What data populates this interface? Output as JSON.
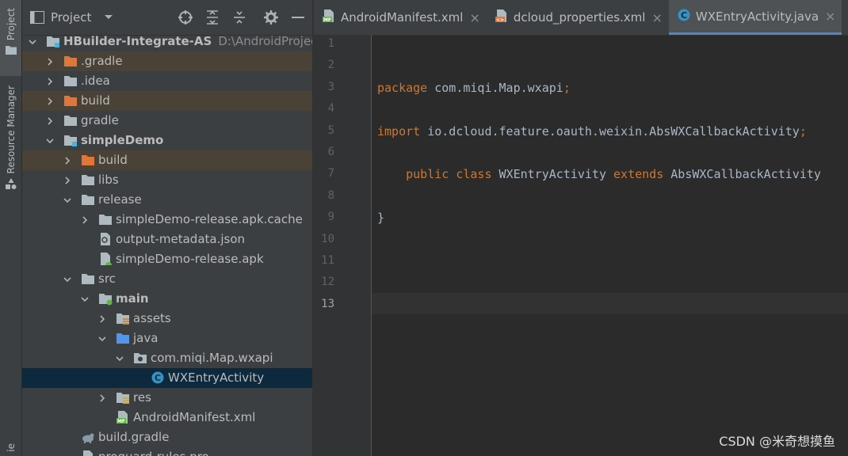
{
  "left_stripe": {
    "tabs": [
      {
        "label": "Project",
        "icon": "folder-icon",
        "active": true
      },
      {
        "label": "Resource Manager",
        "icon": "resource-manager-icon",
        "active": false
      },
      {
        "label": "ie",
        "icon": "",
        "active": false
      }
    ]
  },
  "project_panel": {
    "title": "Project",
    "view_dropdown": "chevron-down-icon",
    "actions": [
      "locate-icon",
      "expand-all-icon",
      "collapse-all-icon",
      "gear-icon",
      "hide-icon"
    ],
    "tree": [
      {
        "label": "HBuilder-Integrate-AS",
        "path": "D:\\AndroidProject\\",
        "depth": 0,
        "icon": "module-folder-icon",
        "expanded": true,
        "bold": true,
        "style": "normal"
      },
      {
        "label": ".gradle",
        "depth": 1,
        "icon": "folder-excluded-icon",
        "expanded": false,
        "style": "excluded"
      },
      {
        "label": ".idea",
        "depth": 1,
        "icon": "folder-icon",
        "expanded": false,
        "style": "normal"
      },
      {
        "label": "build",
        "depth": 1,
        "icon": "folder-excluded-icon",
        "expanded": false,
        "style": "excluded"
      },
      {
        "label": "gradle",
        "depth": 1,
        "icon": "folder-icon",
        "expanded": false,
        "style": "normal"
      },
      {
        "label": "simpleDemo",
        "depth": 1,
        "icon": "module-folder-icon",
        "expanded": true,
        "bold": true,
        "style": "normal"
      },
      {
        "label": "build",
        "depth": 2,
        "icon": "folder-excluded-icon",
        "expanded": false,
        "style": "excluded"
      },
      {
        "label": "libs",
        "depth": 2,
        "icon": "folder-icon",
        "expanded": false,
        "style": "normal"
      },
      {
        "label": "release",
        "depth": 2,
        "icon": "folder-icon",
        "expanded": true,
        "style": "normal"
      },
      {
        "label": "simpleDemo-release.apk.cache",
        "depth": 3,
        "icon": "folder-icon",
        "expanded": false,
        "style": "normal"
      },
      {
        "label": "output-metadata.json",
        "depth": 3,
        "icon": "json-file-icon",
        "leaf": true,
        "style": "normal"
      },
      {
        "label": "simpleDemo-release.apk",
        "depth": 3,
        "icon": "apk-file-icon",
        "leaf": true,
        "style": "normal"
      },
      {
        "label": "src",
        "depth": 2,
        "icon": "folder-icon",
        "expanded": true,
        "style": "normal"
      },
      {
        "label": "main",
        "depth": 3,
        "icon": "source-set-folder-icon",
        "expanded": true,
        "bold": true,
        "style": "normal"
      },
      {
        "label": "assets",
        "depth": 4,
        "icon": "assets-folder-icon",
        "expanded": false,
        "style": "normal"
      },
      {
        "label": "java",
        "depth": 4,
        "icon": "source-root-folder-icon",
        "expanded": true,
        "style": "normal"
      },
      {
        "label": "com.miqi.Map.wxapi",
        "depth": 5,
        "icon": "package-icon",
        "expanded": true,
        "style": "normal"
      },
      {
        "label": "WXEntryActivity",
        "depth": 6,
        "icon": "java-class-icon",
        "leaf": true,
        "style": "selected"
      },
      {
        "label": "res",
        "depth": 4,
        "icon": "resources-folder-icon",
        "expanded": false,
        "style": "normal"
      },
      {
        "label": "AndroidManifest.xml",
        "depth": 4,
        "icon": "manifest-file-icon",
        "leaf": true,
        "style": "normal"
      },
      {
        "label": "build.gradle",
        "depth": 2,
        "icon": "gradle-file-icon",
        "leaf": true,
        "style": "normal"
      },
      {
        "label": "proguard-rules.pro",
        "depth": 2,
        "icon": "file-icon",
        "leaf": true,
        "style": "normal"
      }
    ]
  },
  "editor": {
    "tabs": [
      {
        "label": "AndroidManifest.xml",
        "icon": "manifest-file-icon",
        "active": false
      },
      {
        "label": "dcloud_properties.xml",
        "icon": "xml-file-icon",
        "active": false
      },
      {
        "label": "WXEntryActivity.java",
        "icon": "java-class-icon",
        "active": true
      }
    ],
    "close_glyph": "×",
    "current_line": 13,
    "lines": [
      {
        "n": "1",
        "segments": []
      },
      {
        "n": "2",
        "segments": []
      },
      {
        "n": "3",
        "segments": [
          {
            "t": "package",
            "c": "kw"
          },
          {
            "t": " com.miqi.Map.wxapi",
            "c": "id"
          },
          {
            "t": ";",
            "c": "kw"
          }
        ]
      },
      {
        "n": "4",
        "segments": []
      },
      {
        "n": "5",
        "segments": [
          {
            "t": "import",
            "c": "kw"
          },
          {
            "t": " io.dcloud.feature.oauth.weixin.AbsWXCallbackActivity",
            "c": "id"
          },
          {
            "t": ";",
            "c": "kw"
          }
        ]
      },
      {
        "n": "6",
        "segments": []
      },
      {
        "n": "7",
        "segments": [
          {
            "t": "    public class",
            "c": "kw"
          },
          {
            "t": " WXEntryActivity ",
            "c": "id"
          },
          {
            "t": "extends",
            "c": "kw"
          },
          {
            "t": " AbsWXCallbackActivity",
            "c": "id"
          }
        ]
      },
      {
        "n": "8",
        "segments": []
      },
      {
        "n": "9",
        "segments": [
          {
            "t": "}",
            "c": "id"
          }
        ]
      },
      {
        "n": "10",
        "segments": []
      },
      {
        "n": "11",
        "segments": []
      },
      {
        "n": "12",
        "segments": []
      },
      {
        "n": "13",
        "segments": []
      }
    ]
  },
  "watermark": "CSDN @米奇想摸鱼",
  "colors": {
    "keyword": "#cc7832",
    "identifier": "#a9b7c6",
    "selection": "#0d293e",
    "excluded": "#4b4237",
    "tab_underline": "#4a88c7"
  }
}
